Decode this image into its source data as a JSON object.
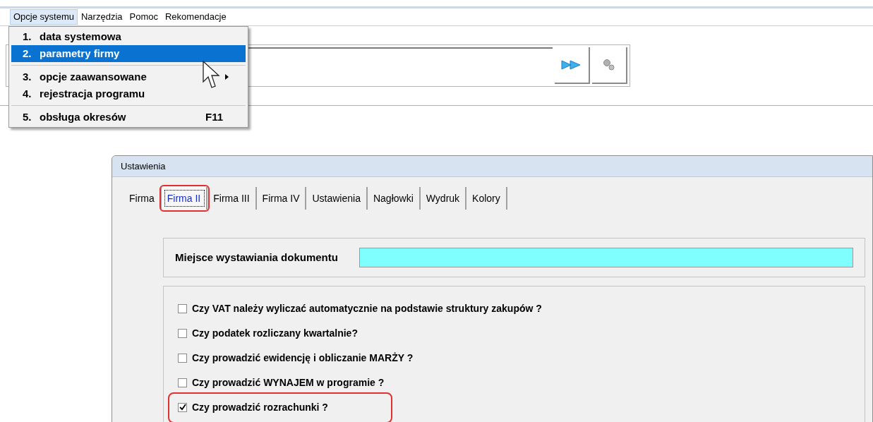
{
  "menu_bar": [
    {
      "label": "Opcje systemu",
      "selected": true
    },
    {
      "label": "Narzędzia",
      "selected": false
    },
    {
      "label": "Pomoc",
      "selected": false
    },
    {
      "label": "Rekomendacje",
      "selected": false
    }
  ],
  "menu": [
    {
      "kind": "item",
      "number": "1.",
      "label": "data systemowa",
      "selected": false,
      "submenu": false
    },
    {
      "kind": "item",
      "number": "2.",
      "label": "parametry firmy",
      "selected": true,
      "submenu": false
    },
    {
      "kind": "separator"
    },
    {
      "kind": "item",
      "number": "3.",
      "label": "opcje zaawansowane",
      "selected": false,
      "submenu": true
    },
    {
      "kind": "item",
      "number": "4.",
      "label": "rejestracja programu",
      "selected": false,
      "submenu": false
    },
    {
      "kind": "separator"
    },
    {
      "kind": "item",
      "number": "5.",
      "label": "obsługa okresów",
      "selected": false,
      "submenu": false,
      "shortcut": "F11"
    }
  ],
  "dialog": {
    "title": "Ustawienia",
    "tabs": [
      {
        "label": "Firma",
        "selected": false,
        "highlighted": false
      },
      {
        "label": "Firma II",
        "selected": true,
        "highlighted": true
      },
      {
        "label": "Firma III",
        "selected": false,
        "highlighted": false
      },
      {
        "label": "Firma IV",
        "selected": false,
        "highlighted": false
      },
      {
        "label": "Ustawienia",
        "selected": false,
        "highlighted": false
      },
      {
        "label": "Nagłowki",
        "selected": false,
        "highlighted": false
      },
      {
        "label": "Wydruk",
        "selected": false,
        "highlighted": false
      },
      {
        "label": "Kolory",
        "selected": false,
        "highlighted": false
      }
    ],
    "place_field": {
      "label": "Miejsce wystawiania dokumentu"
    },
    "options": [
      {
        "label": "Czy VAT należy wyliczać automatycznie na podstawie struktury zakupów ?",
        "checked": false,
        "highlighted": false
      },
      {
        "label": "Czy podatek rozliczany kwartalnie?",
        "checked": false,
        "highlighted": false
      },
      {
        "label": "Czy prowadzić ewidencję i obliczanie MARŻY ?",
        "checked": false,
        "highlighted": false
      },
      {
        "label": "Czy prowadzić WYNAJEM w programie ?",
        "checked": false,
        "highlighted": false
      },
      {
        "label": "Czy prowadzić rozrachunki ?",
        "checked": true,
        "highlighted": true
      }
    ]
  }
}
